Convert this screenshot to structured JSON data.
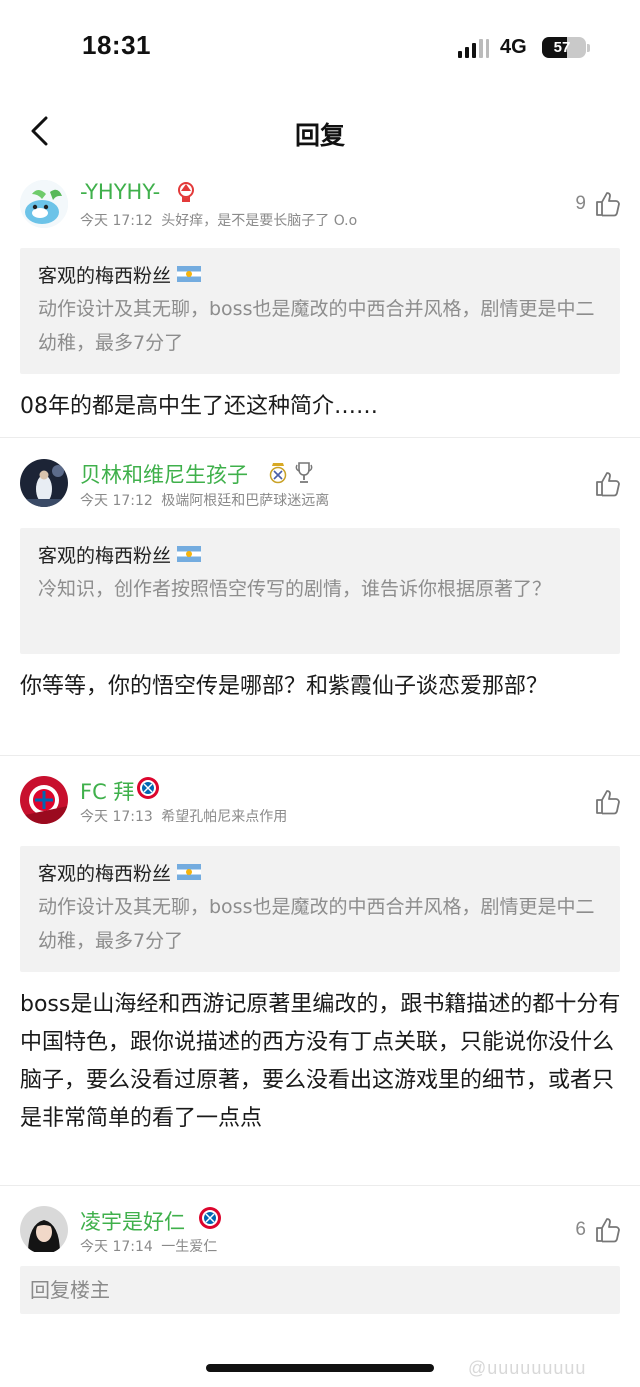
{
  "status_bar": {
    "time": "18:31",
    "network": "4G",
    "battery": "57",
    "battery_level": 0.57
  },
  "nav": {
    "title": "回复"
  },
  "comments": [
    {
      "user": "-YHYHY-",
      "time": "今天 17:12",
      "bio": "头好痒，是不是要长脑子了 O.o",
      "likes": "9",
      "quote": {
        "author": "客观的梅西粉丝",
        "text": "动作设计及其无聊，boss也是魔改的中西合并风格，剧情更是中二幼稚，最多7分了"
      },
      "reply": "08年的都是高中生了还这种简介……"
    },
    {
      "user": "贝林和维尼生孩子",
      "time": "今天 17:12",
      "bio": "极端阿根廷和巴萨球迷远离",
      "likes": "",
      "quote": {
        "author": "客观的梅西粉丝",
        "text": "冷知识，创作者按照悟空传写的剧情，谁告诉你根据原著了？"
      },
      "reply": "你等等，你的悟空传是哪部？和紫霞仙子谈恋爱那部？"
    },
    {
      "user": "FC 拜",
      "time": "今天 17:13",
      "bio": "希望孔帕尼来点作用",
      "likes": "",
      "quote": {
        "author": "客观的梅西粉丝",
        "text": "动作设计及其无聊，boss也是魔改的中西合并风格，剧情更是中二幼稚，最多7分了"
      },
      "reply": "boss是山海经和西游记原著里编改的，跟书籍描述的都十分有中国特色，跟你说描述的西方没有丁点关联，只能说你没什么脑子，要么没看过原著，要么没看出这游戏里的细节，或者只是非常简单的看了一点点"
    },
    {
      "user": "凌宇是好仁",
      "time": "今天 17:14",
      "bio": "一生爱仁",
      "likes": "6"
    }
  ],
  "reply_bar": {
    "placeholder": "回复楼主"
  },
  "watermark": "@uuuuuuuuu",
  "colors": {
    "username": "#3fb04b",
    "quote_bg": "#f2f2f2",
    "meta": "#8a8a8a"
  },
  "icons": [
    "back-chevron-icon",
    "thumbs-up-icon",
    "nottingham-forest-badge-icon",
    "real-madrid-badge-icon",
    "champions-trophy-icon",
    "bayern-badge-icon",
    "argentina-flag-icon"
  ]
}
